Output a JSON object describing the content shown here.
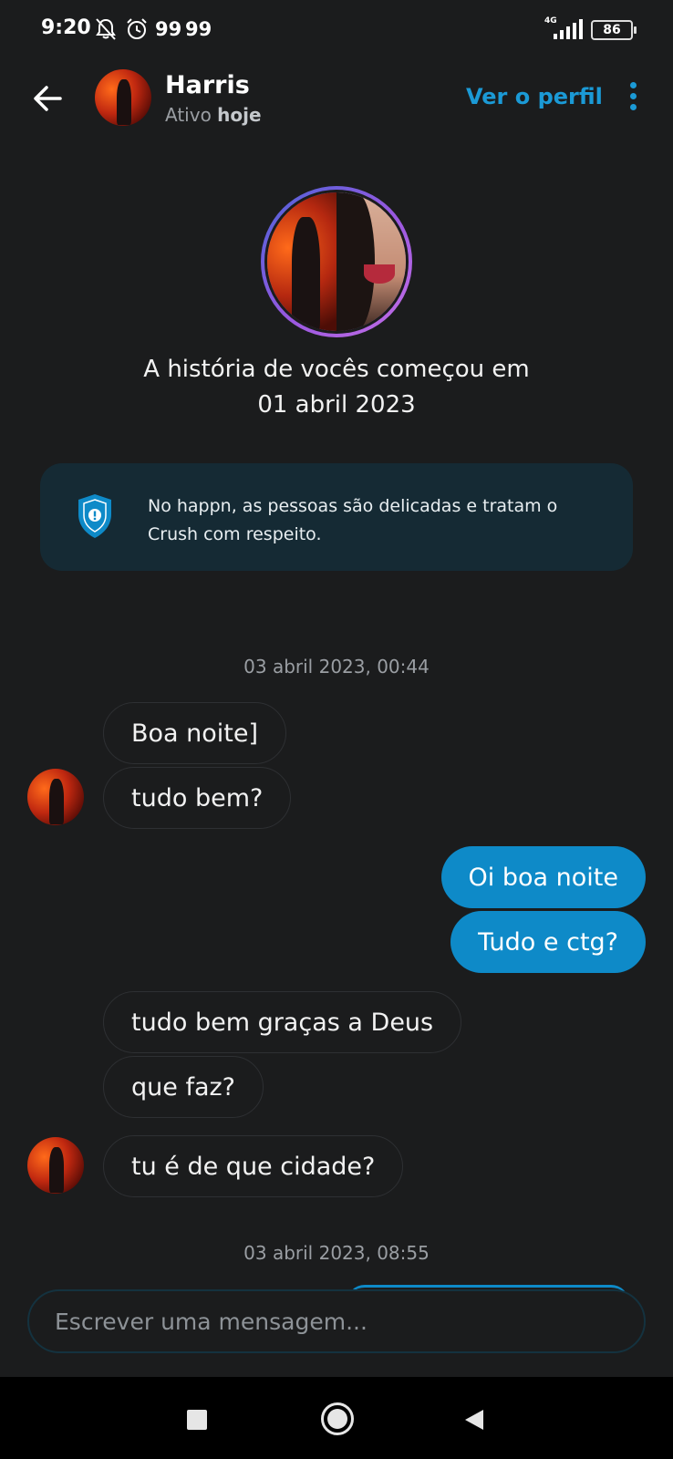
{
  "status_bar": {
    "time": "9:20",
    "notif_a": "99",
    "notif_b": "99",
    "network": "4G",
    "battery": "86"
  },
  "header": {
    "name": "Harris",
    "status_prefix": "Ativo",
    "status_when": "hoje",
    "view_profile": "Ver o perfil"
  },
  "match": {
    "story_line1": "A história de vocês começou em",
    "story_line2": "01 abril 2023"
  },
  "safety": {
    "text": "No happn, as pessoas são delicadas e tratam o Crush com respeito."
  },
  "conversation": {
    "date_1": "03 abril 2023, 00:44",
    "date_2": "03 abril 2023, 08:55",
    "messages": [
      {
        "from": "them",
        "text": "Boa noite]"
      },
      {
        "from": "them",
        "text": "tudo bem?"
      },
      {
        "from": "me",
        "text": "Oi boa noite"
      },
      {
        "from": "me",
        "text": "Tudo e ctg?"
      },
      {
        "from": "them",
        "text": "tudo bem graças a Deus"
      },
      {
        "from": "them",
        "text": "que faz?"
      },
      {
        "from": "them",
        "text": "tu é de que cidade?"
      }
    ]
  },
  "composer": {
    "placeholder": "Escrever uma mensagem..."
  },
  "colors": {
    "background": "#1b1c1d",
    "accent": "#1b9ad6",
    "outgoing_bubble": "#0e8ac8",
    "safety_card": "#152a34"
  }
}
